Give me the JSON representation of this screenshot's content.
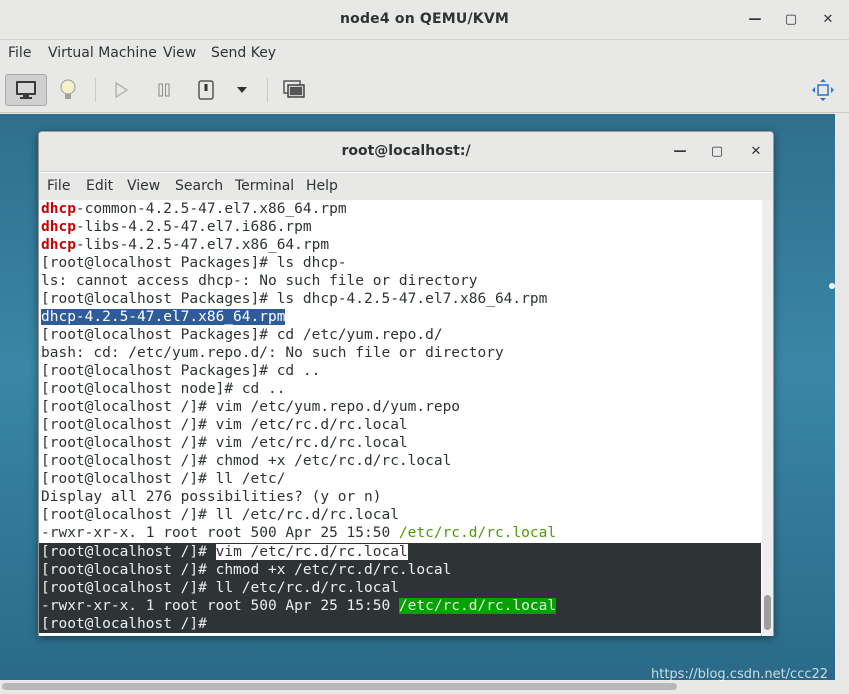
{
  "outer": {
    "title": "node4 on QEMU/KVM",
    "controls": {
      "minimize": "—",
      "maximize": "▢",
      "close": "✕"
    },
    "menu": [
      "File",
      "Virtual Machine",
      "View",
      "Send Key"
    ]
  },
  "toolbar_icons": [
    "monitor-icon",
    "lightbulb-icon",
    "play-icon",
    "pause-icon",
    "power-icon",
    "dropdown-arrow-icon",
    "screenshot-icon",
    "fullscreen-icon"
  ],
  "terminal": {
    "title": "root@localhost:/",
    "controls": {
      "minimize": "—",
      "maximize": "▢",
      "close": "✕"
    },
    "menu": [
      "File",
      "Edit",
      "View",
      "Search",
      "Terminal",
      "Help"
    ],
    "lines": [
      {
        "hl": "dhcp",
        "rest": "-common-4.2.5-47.el7.x86_64.rpm"
      },
      {
        "hl": "dhcp",
        "rest": "-libs-4.2.5-47.el7.i686.rpm"
      },
      {
        "hl": "dhcp",
        "rest": "-libs-4.2.5-47.el7.x86_64.rpm"
      },
      {
        "text": "[root@localhost Packages]# ls dhcp-"
      },
      {
        "text": "ls: cannot access dhcp-: No such file or directory"
      },
      {
        "text": "[root@localhost Packages]# ls dhcp-4.2.5-47.el7.x86_64.rpm"
      },
      {
        "selected": "dhcp-4.2.5-47.el7.x86_64.rpm"
      },
      {
        "text": "[root@localhost Packages]# cd /etc/yum.repo.d/"
      },
      {
        "text": "bash: cd: /etc/yum.repo.d/: No such file or directory"
      },
      {
        "text": "[root@localhost Packages]# cd .."
      },
      {
        "text": "[root@localhost node]# cd .."
      },
      {
        "text": "[root@localhost /]# vim /etc/yum.repo.d/yum.repo"
      },
      {
        "text": "[root@localhost /]# vim /etc/rc.d/rc.local"
      },
      {
        "text": "[root@localhost /]# vim /etc/rc.d/rc.local"
      },
      {
        "text": "[root@localhost /]# chmod +x /etc/rc.d/rc.local"
      },
      {
        "text": "[root@localhost /]# ll /etc/"
      },
      {
        "text": "Display all 276 possibilities? (y or n)"
      },
      {
        "text": "[root@localhost /]# ll /etc/rc.d/rc.local"
      },
      {
        "prefix": "-rwxr-xr-x. 1 root root 500 Apr 25 15:50 ",
        "green": "/etc/rc.d/rc.local"
      }
    ],
    "dark_lines": [
      {
        "prefix": "[root@localhost /]# ",
        "inverse": "vim /etc/rc.d/rc.local"
      },
      {
        "prefix": "[root@localhost /]# chmod +x /etc/rc.d/rc.local"
      },
      {
        "prefix": "[root@localhost /]# ll /etc/rc.d/rc.local"
      },
      {
        "prefix": "-rwxr-xr-x. 1 root root 500 Apr 25 15:50 ",
        "green": "/etc/rc.d/rc.local"
      },
      {
        "prefix": "[root@localhost /]# "
      }
    ]
  },
  "watermark": "https://blog.csdn.net/ccc22"
}
